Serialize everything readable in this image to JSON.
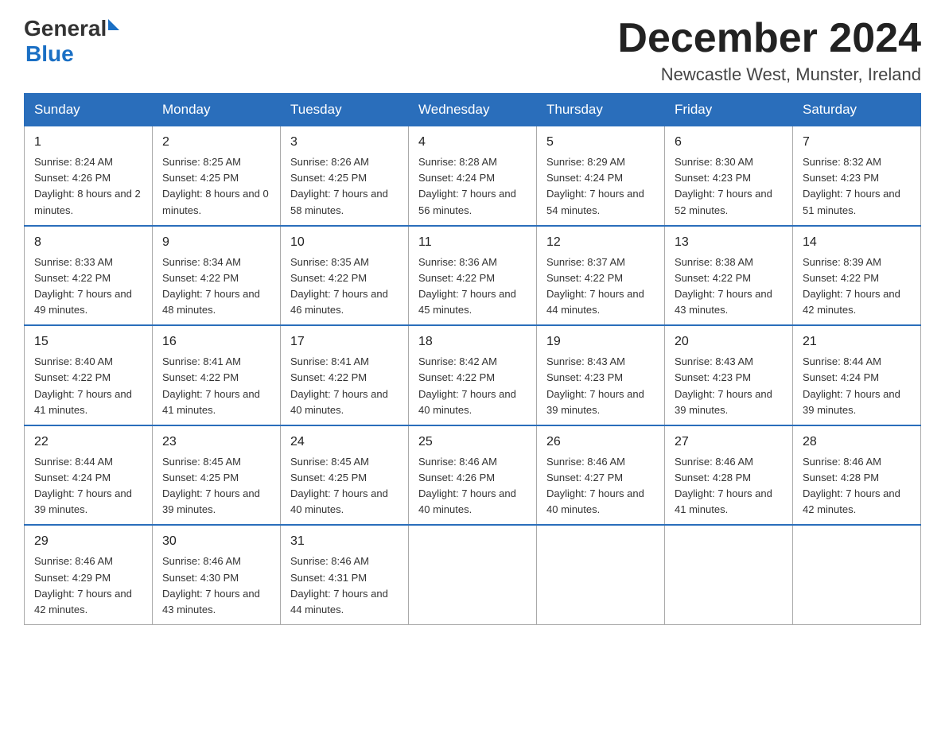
{
  "header": {
    "logo": {
      "general": "General",
      "arrow": "▶",
      "blue": "Blue"
    },
    "title": "December 2024",
    "location": "Newcastle West, Munster, Ireland"
  },
  "calendar": {
    "days_of_week": [
      "Sunday",
      "Monday",
      "Tuesday",
      "Wednesday",
      "Thursday",
      "Friday",
      "Saturday"
    ],
    "weeks": [
      [
        {
          "day": "1",
          "sunrise": "8:24 AM",
          "sunset": "4:26 PM",
          "daylight": "8 hours and 2 minutes."
        },
        {
          "day": "2",
          "sunrise": "8:25 AM",
          "sunset": "4:25 PM",
          "daylight": "8 hours and 0 minutes."
        },
        {
          "day": "3",
          "sunrise": "8:26 AM",
          "sunset": "4:25 PM",
          "daylight": "7 hours and 58 minutes."
        },
        {
          "day": "4",
          "sunrise": "8:28 AM",
          "sunset": "4:24 PM",
          "daylight": "7 hours and 56 minutes."
        },
        {
          "day": "5",
          "sunrise": "8:29 AM",
          "sunset": "4:24 PM",
          "daylight": "7 hours and 54 minutes."
        },
        {
          "day": "6",
          "sunrise": "8:30 AM",
          "sunset": "4:23 PM",
          "daylight": "7 hours and 52 minutes."
        },
        {
          "day": "7",
          "sunrise": "8:32 AM",
          "sunset": "4:23 PM",
          "daylight": "7 hours and 51 minutes."
        }
      ],
      [
        {
          "day": "8",
          "sunrise": "8:33 AM",
          "sunset": "4:22 PM",
          "daylight": "7 hours and 49 minutes."
        },
        {
          "day": "9",
          "sunrise": "8:34 AM",
          "sunset": "4:22 PM",
          "daylight": "7 hours and 48 minutes."
        },
        {
          "day": "10",
          "sunrise": "8:35 AM",
          "sunset": "4:22 PM",
          "daylight": "7 hours and 46 minutes."
        },
        {
          "day": "11",
          "sunrise": "8:36 AM",
          "sunset": "4:22 PM",
          "daylight": "7 hours and 45 minutes."
        },
        {
          "day": "12",
          "sunrise": "8:37 AM",
          "sunset": "4:22 PM",
          "daylight": "7 hours and 44 minutes."
        },
        {
          "day": "13",
          "sunrise": "8:38 AM",
          "sunset": "4:22 PM",
          "daylight": "7 hours and 43 minutes."
        },
        {
          "day": "14",
          "sunrise": "8:39 AM",
          "sunset": "4:22 PM",
          "daylight": "7 hours and 42 minutes."
        }
      ],
      [
        {
          "day": "15",
          "sunrise": "8:40 AM",
          "sunset": "4:22 PM",
          "daylight": "7 hours and 41 minutes."
        },
        {
          "day": "16",
          "sunrise": "8:41 AM",
          "sunset": "4:22 PM",
          "daylight": "7 hours and 41 minutes."
        },
        {
          "day": "17",
          "sunrise": "8:41 AM",
          "sunset": "4:22 PM",
          "daylight": "7 hours and 40 minutes."
        },
        {
          "day": "18",
          "sunrise": "8:42 AM",
          "sunset": "4:22 PM",
          "daylight": "7 hours and 40 minutes."
        },
        {
          "day": "19",
          "sunrise": "8:43 AM",
          "sunset": "4:23 PM",
          "daylight": "7 hours and 39 minutes."
        },
        {
          "day": "20",
          "sunrise": "8:43 AM",
          "sunset": "4:23 PM",
          "daylight": "7 hours and 39 minutes."
        },
        {
          "day": "21",
          "sunrise": "8:44 AM",
          "sunset": "4:24 PM",
          "daylight": "7 hours and 39 minutes."
        }
      ],
      [
        {
          "day": "22",
          "sunrise": "8:44 AM",
          "sunset": "4:24 PM",
          "daylight": "7 hours and 39 minutes."
        },
        {
          "day": "23",
          "sunrise": "8:45 AM",
          "sunset": "4:25 PM",
          "daylight": "7 hours and 39 minutes."
        },
        {
          "day": "24",
          "sunrise": "8:45 AM",
          "sunset": "4:25 PM",
          "daylight": "7 hours and 40 minutes."
        },
        {
          "day": "25",
          "sunrise": "8:46 AM",
          "sunset": "4:26 PM",
          "daylight": "7 hours and 40 minutes."
        },
        {
          "day": "26",
          "sunrise": "8:46 AM",
          "sunset": "4:27 PM",
          "daylight": "7 hours and 40 minutes."
        },
        {
          "day": "27",
          "sunrise": "8:46 AM",
          "sunset": "4:28 PM",
          "daylight": "7 hours and 41 minutes."
        },
        {
          "day": "28",
          "sunrise": "8:46 AM",
          "sunset": "4:28 PM",
          "daylight": "7 hours and 42 minutes."
        }
      ],
      [
        {
          "day": "29",
          "sunrise": "8:46 AM",
          "sunset": "4:29 PM",
          "daylight": "7 hours and 42 minutes."
        },
        {
          "day": "30",
          "sunrise": "8:46 AM",
          "sunset": "4:30 PM",
          "daylight": "7 hours and 43 minutes."
        },
        {
          "day": "31",
          "sunrise": "8:46 AM",
          "sunset": "4:31 PM",
          "daylight": "7 hours and 44 minutes."
        },
        null,
        null,
        null,
        null
      ]
    ]
  }
}
